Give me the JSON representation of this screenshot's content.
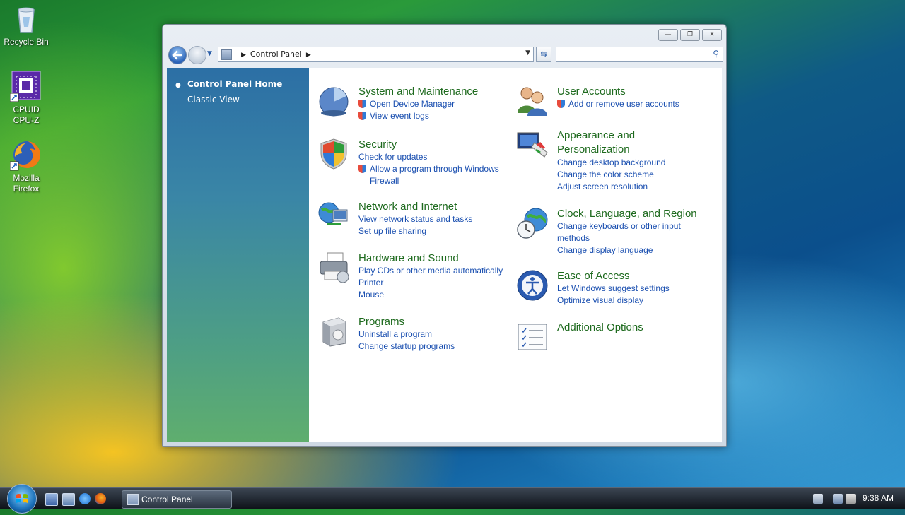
{
  "desktop": {
    "icons": [
      {
        "label": "Recycle Bin",
        "icon": "recycle-bin-icon"
      },
      {
        "label": "CPUID\nCPU-Z",
        "line1": "CPUID",
        "line2": "CPU-Z",
        "icon": "cpu-z-icon"
      },
      {
        "label": "Mozilla\nFirefox",
        "line1": "Mozilla",
        "line2": "Firefox",
        "icon": "firefox-icon"
      }
    ]
  },
  "window": {
    "address": {
      "crumb": "Control Panel"
    },
    "search": {
      "placeholder": "",
      "value": ""
    },
    "sidebar": {
      "items": [
        {
          "label": "Control Panel Home"
        },
        {
          "label": "Classic View"
        }
      ]
    },
    "categories": [
      {
        "title": "System and Maintenance",
        "icon": "system-maintenance-icon",
        "links": [
          {
            "label": "Open Device Manager"
          },
          {
            "label": "View event logs"
          }
        ]
      },
      {
        "title": "Security",
        "icon": "security-shield-icon",
        "links": [
          {
            "label": "Check for updates"
          },
          {
            "label": "Allow a program through Windows Firewall"
          }
        ]
      },
      {
        "title": "Network and Internet",
        "icon": "network-globe-icon",
        "links": [
          {
            "label": "View network status and tasks"
          },
          {
            "label": "Set up file sharing"
          }
        ]
      },
      {
        "title": "Hardware and Sound",
        "icon": "printer-icon",
        "links": [
          {
            "label": "Play CDs or other media automatically"
          },
          {
            "label": "Printer"
          },
          {
            "label": "Mouse"
          }
        ]
      },
      {
        "title": "Programs",
        "icon": "programs-box-icon",
        "links": [
          {
            "label": "Uninstall a program"
          },
          {
            "label": "Change startup programs"
          }
        ]
      },
      {
        "title": "User Accounts",
        "icon": "user-accounts-icon",
        "links": [
          {
            "label": "Add or remove user accounts"
          }
        ]
      },
      {
        "title": "Appearance and Personalization",
        "title_line1": "Appearance and",
        "title_line2": "Personalization",
        "icon": "appearance-monitor-icon",
        "links": [
          {
            "label": "Change desktop background"
          },
          {
            "label": "Change the color scheme"
          },
          {
            "label": "Adjust screen resolution"
          }
        ]
      },
      {
        "title": "Clock, Language, and Region",
        "icon": "clock-globe-icon",
        "links": [
          {
            "label": "Change keyboards or other input methods"
          },
          {
            "label": "Change display language"
          }
        ]
      },
      {
        "title": "Ease of Access",
        "icon": "ease-of-access-icon",
        "links": [
          {
            "label": "Let Windows suggest settings"
          },
          {
            "label": "Optimize visual display"
          }
        ]
      },
      {
        "title": "Additional Options",
        "icon": "additional-options-icon",
        "links": []
      }
    ]
  },
  "taskbar": {
    "task_button": {
      "label": "Control Panel"
    },
    "clock": "9:38 AM"
  },
  "colors": {
    "category_title": "#1e6a1e",
    "link": "#1a4fb0"
  }
}
